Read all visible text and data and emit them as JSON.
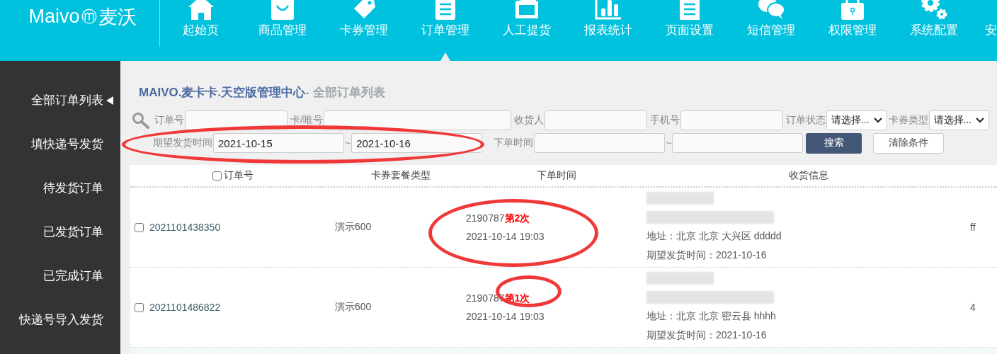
{
  "brand": {
    "name": "Maivo",
    "mark": "ⓜ",
    "suffix": "麦沃"
  },
  "nav": [
    {
      "label": "起始页",
      "selected": false
    },
    {
      "label": "商品管理",
      "selected": false
    },
    {
      "label": "卡券管理",
      "selected": false
    },
    {
      "label": "订单管理",
      "selected": true
    },
    {
      "label": "人工提货",
      "selected": false
    },
    {
      "label": "报表统计",
      "selected": false
    },
    {
      "label": "页面设置",
      "selected": false
    },
    {
      "label": "短信管理",
      "selected": false
    },
    {
      "label": "权限管理",
      "selected": false
    },
    {
      "label": "系统配置",
      "selected": false
    },
    {
      "label": "安",
      "selected": false
    }
  ],
  "sidebar": {
    "items": [
      {
        "label": "全部订单列表",
        "selected": true
      },
      {
        "label": "填快递号发货",
        "selected": false
      },
      {
        "label": "待发货订单",
        "selected": false
      },
      {
        "label": "已发货订单",
        "selected": false
      },
      {
        "label": "已完成订单",
        "selected": false
      },
      {
        "label": "快递号导入发货",
        "selected": false
      }
    ]
  },
  "page_title": {
    "site": "MAIVO.麦卡卡.天空版管理中心",
    "section": "- 全部订单列表"
  },
  "filters": {
    "row_1": [
      {
        "kind": "input",
        "label": "订单号"
      },
      {
        "kind": "input",
        "label": "卡/唯号"
      },
      {
        "kind": "input",
        "label": "收货人"
      },
      {
        "kind": "input",
        "label": "手机号"
      },
      {
        "kind": "select",
        "label": "订单状态",
        "value": "请选择..."
      },
      {
        "kind": "select",
        "label": "卡券类型",
        "value": "请选择..."
      }
    ],
    "expected_ship": {
      "label": "期望发货时间",
      "from": "2021-10-15",
      "separator": "~",
      "to": "2021-10-16"
    },
    "order_time": {
      "label": "下单时间",
      "separator": "~"
    },
    "search_button": "搜索",
    "clear_button": "清除条件"
  },
  "table": {
    "columns": [
      {
        "kind": "checkbox",
        "label": "订单号",
        "checked": false
      },
      {
        "kind": "text",
        "label": "卡券套餐类型"
      },
      {
        "kind": "text",
        "label": "下单时间"
      },
      {
        "kind": "text",
        "label": "收货信息"
      }
    ],
    "rows": [
      {
        "checked": false,
        "order_no": "2021101438350",
        "package": "演示600",
        "code": "2190787",
        "count": "第2次",
        "time": "2021-10-14 19:03",
        "address": "地址：北京 北京 大兴区 ddddd",
        "expected": "期望发货时间：2021-10-16",
        "column_5": "ff"
      },
      {
        "checked": false,
        "order_no": "2021101486822",
        "package": "演示600",
        "code": "2190787",
        "count": "第1次",
        "time": "2021-10-14 19:03",
        "address": "地址：北京 北京 密云县 hhhh",
        "expected": "期望发货时间：2021-10-16",
        "column_5": "4"
      }
    ]
  }
}
